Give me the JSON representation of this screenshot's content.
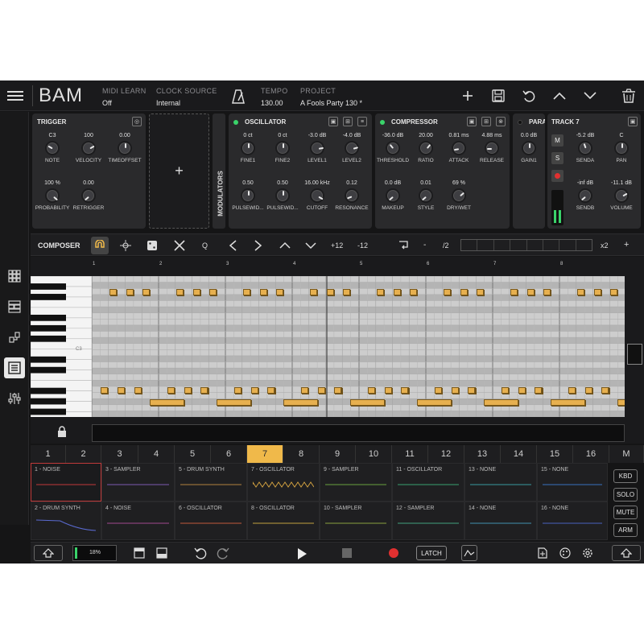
{
  "header": {
    "logo": "BAM",
    "midi_learn_label": "MIDI LEARN",
    "midi_learn_value": "Off",
    "clock_source_label": "CLOCK SOURCE",
    "clock_source_value": "Internal",
    "tempo_label": "TEMPO",
    "tempo_value": "130.00",
    "project_label": "PROJECT",
    "project_value": "A Fools Party 130 *"
  },
  "trigger": {
    "title": "TRIGGER",
    "knobs": [
      {
        "value": "C3",
        "label": "NOTE"
      },
      {
        "value": "100",
        "label": "VELOCITY"
      },
      {
        "value": "0.00",
        "label": "TIMEOFFSET"
      },
      {
        "value": "100 %",
        "label": "PROBABILITY"
      },
      {
        "value": "0.00",
        "label": "RETRIGGER"
      }
    ]
  },
  "modulators_label": "MODULATORS",
  "add_symbol": "+",
  "oscillator": {
    "title": "OSCILLATOR",
    "knobs": [
      {
        "value": "0 ct",
        "label": "FINE1"
      },
      {
        "value": "0 ct",
        "label": "FINE2"
      },
      {
        "value": "-3.0 dB",
        "label": "LEVEL1"
      },
      {
        "value": "-4.0 dB",
        "label": "LEVEL2"
      },
      {
        "value": "0.50",
        "label": "PULSEWID..."
      },
      {
        "value": "0.50",
        "label": "PULSEWID..."
      },
      {
        "value": "16.00 kHz",
        "label": "CUTOFF"
      },
      {
        "value": "0.12",
        "label": "RESONANCE"
      }
    ]
  },
  "compressor": {
    "title": "COMPRESSOR",
    "knobs": [
      {
        "value": "-36.0 dB",
        "label": "THRESHOLD"
      },
      {
        "value": "20.00",
        "label": "RATIO"
      },
      {
        "value": "0.81 ms",
        "label": "ATTACK"
      },
      {
        "value": "4.88 ms",
        "label": "RELEASE"
      },
      {
        "value": "0.0 dB",
        "label": "MAKEUP"
      },
      {
        "value": "0.01",
        "label": "STYLE"
      },
      {
        "value": "69 %",
        "label": "DRY/WET"
      }
    ]
  },
  "params": {
    "title": "PARA",
    "knob": {
      "value": "0.0 dB",
      "label": "GAIN1"
    }
  },
  "track": {
    "title": "TRACK 7",
    "m": "M",
    "s": "S",
    "knobs": [
      {
        "value": "-5.2 dB",
        "label": "SENDA"
      },
      {
        "value": "C",
        "label": "PAN"
      },
      {
        "value": "-inf dB",
        "label": "SENDB"
      },
      {
        "value": "-11.1 dB",
        "label": "VOLUME"
      }
    ]
  },
  "composer": {
    "title": "COMPOSER",
    "q_label": "Q",
    "plus12": "+12",
    "minus12": "-12",
    "minus": "-",
    "div": "/2",
    "x2": "x2",
    "plus": "+",
    "c3_label": "C3",
    "bars": [
      "1",
      "2",
      "3",
      "4",
      "5",
      "6",
      "7",
      "8"
    ]
  },
  "tracks": {
    "numbers": [
      "1",
      "2",
      "3",
      "4",
      "5",
      "6",
      "7",
      "8",
      "9",
      "10",
      "11",
      "12",
      "13",
      "14",
      "15",
      "16"
    ],
    "m_label": "M",
    "selected": "7",
    "cells_top": [
      {
        "name": "1 - NOISE",
        "color": "#c03a3a"
      },
      {
        "name": "3 - SAMPLER",
        "color": "#7d5ab0"
      },
      {
        "name": "5 - DRUM SYNTH",
        "color": "#b08040"
      },
      {
        "name": "7 - OSCILLATOR",
        "color": "#d0a040"
      },
      {
        "name": "9 - SAMPLER",
        "color": "#6aa040"
      },
      {
        "name": "11 - OSCILLATOR",
        "color": "#3aa070"
      },
      {
        "name": "13 - NONE",
        "color": "#3a9aa0"
      },
      {
        "name": "15 - NONE",
        "color": "#3a70c0"
      }
    ],
    "cells_bottom": [
      {
        "name": "2 - DRUM SYNTH",
        "color": "#5a6ad0"
      },
      {
        "name": "4 - NOISE",
        "color": "#a04a90"
      },
      {
        "name": "6 - OSCILLATOR",
        "color": "#c05a3a"
      },
      {
        "name": "8 - OSCILLATOR",
        "color": "#c0a040"
      },
      {
        "name": "10 - SAMPLER",
        "color": "#8aa040"
      },
      {
        "name": "12 - SAMPLER",
        "color": "#40a080"
      },
      {
        "name": "14 - NONE",
        "color": "#4090b0"
      },
      {
        "name": "16 - NONE",
        "color": "#4a60c0"
      }
    ],
    "side_buttons": [
      "KBD",
      "SOLO",
      "MUTE",
      "ARM"
    ]
  },
  "footer": {
    "cpu": "18%",
    "latch": "LATCH"
  },
  "colors": {
    "accent": "#f0b94a",
    "record": "#e03030",
    "active_dot": "#3ad36a"
  }
}
